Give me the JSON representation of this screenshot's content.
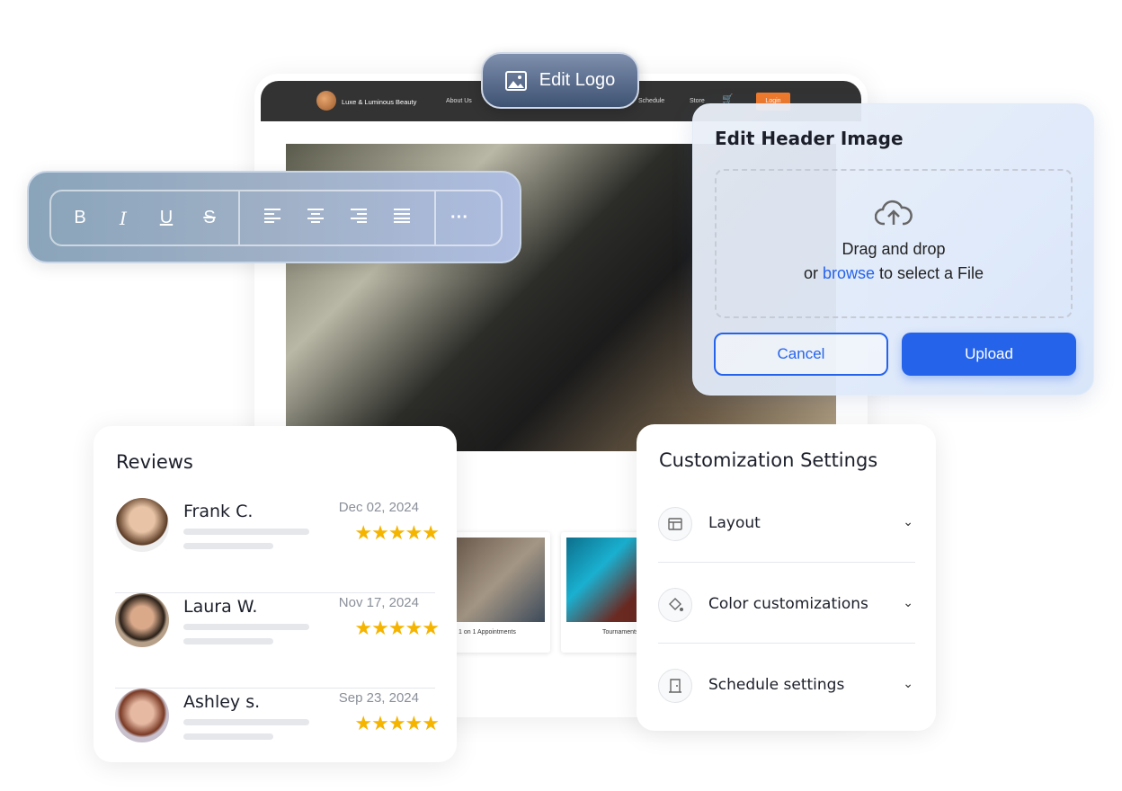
{
  "site": {
    "brand": "Luxe & Luminous Beauty",
    "nav": [
      "About Us",
      "Schedule",
      "Store"
    ],
    "login": "Login",
    "cards": [
      {
        "caption": "1 on 1 Appointments"
      },
      {
        "caption": "Tournaments"
      }
    ],
    "accent": "#f07a2c"
  },
  "edit_logo": {
    "label": "Edit Logo",
    "icon": "image-icon"
  },
  "toolbar": {
    "format": [
      {
        "label": "B",
        "icon": "bold-icon"
      },
      {
        "label": "I",
        "icon": "italic-icon"
      },
      {
        "label": "U",
        "icon": "underline-icon"
      },
      {
        "label": "S",
        "icon": "strikethrough-icon"
      }
    ],
    "align": [
      "align-left-icon",
      "align-center-icon",
      "align-right-icon",
      "align-justify-icon"
    ],
    "more": "···"
  },
  "upload": {
    "title": "Edit Header Image",
    "drag": "Drag and drop",
    "or": "or ",
    "browse": "browse",
    "rest": " to select a File",
    "cancel": "Cancel",
    "upload": "Upload",
    "accent": "#2563eb"
  },
  "reviews": {
    "title": "Reviews",
    "items": [
      {
        "name": "Frank C.",
        "date": "Dec 02, 2024",
        "rating": 5
      },
      {
        "name": "Laura W.",
        "date": "Nov 17, 2024",
        "rating": 5
      },
      {
        "name": "Ashley s.",
        "date": "Sep 23, 2024",
        "rating": 5
      }
    ],
    "star_color": "#f5b400"
  },
  "customization": {
    "title": "Customization Settings",
    "items": [
      {
        "label": "Layout",
        "icon": "layout-icon"
      },
      {
        "label": "Color customizations",
        "icon": "paint-bucket-icon"
      },
      {
        "label": "Schedule settings",
        "icon": "door-icon"
      }
    ]
  }
}
